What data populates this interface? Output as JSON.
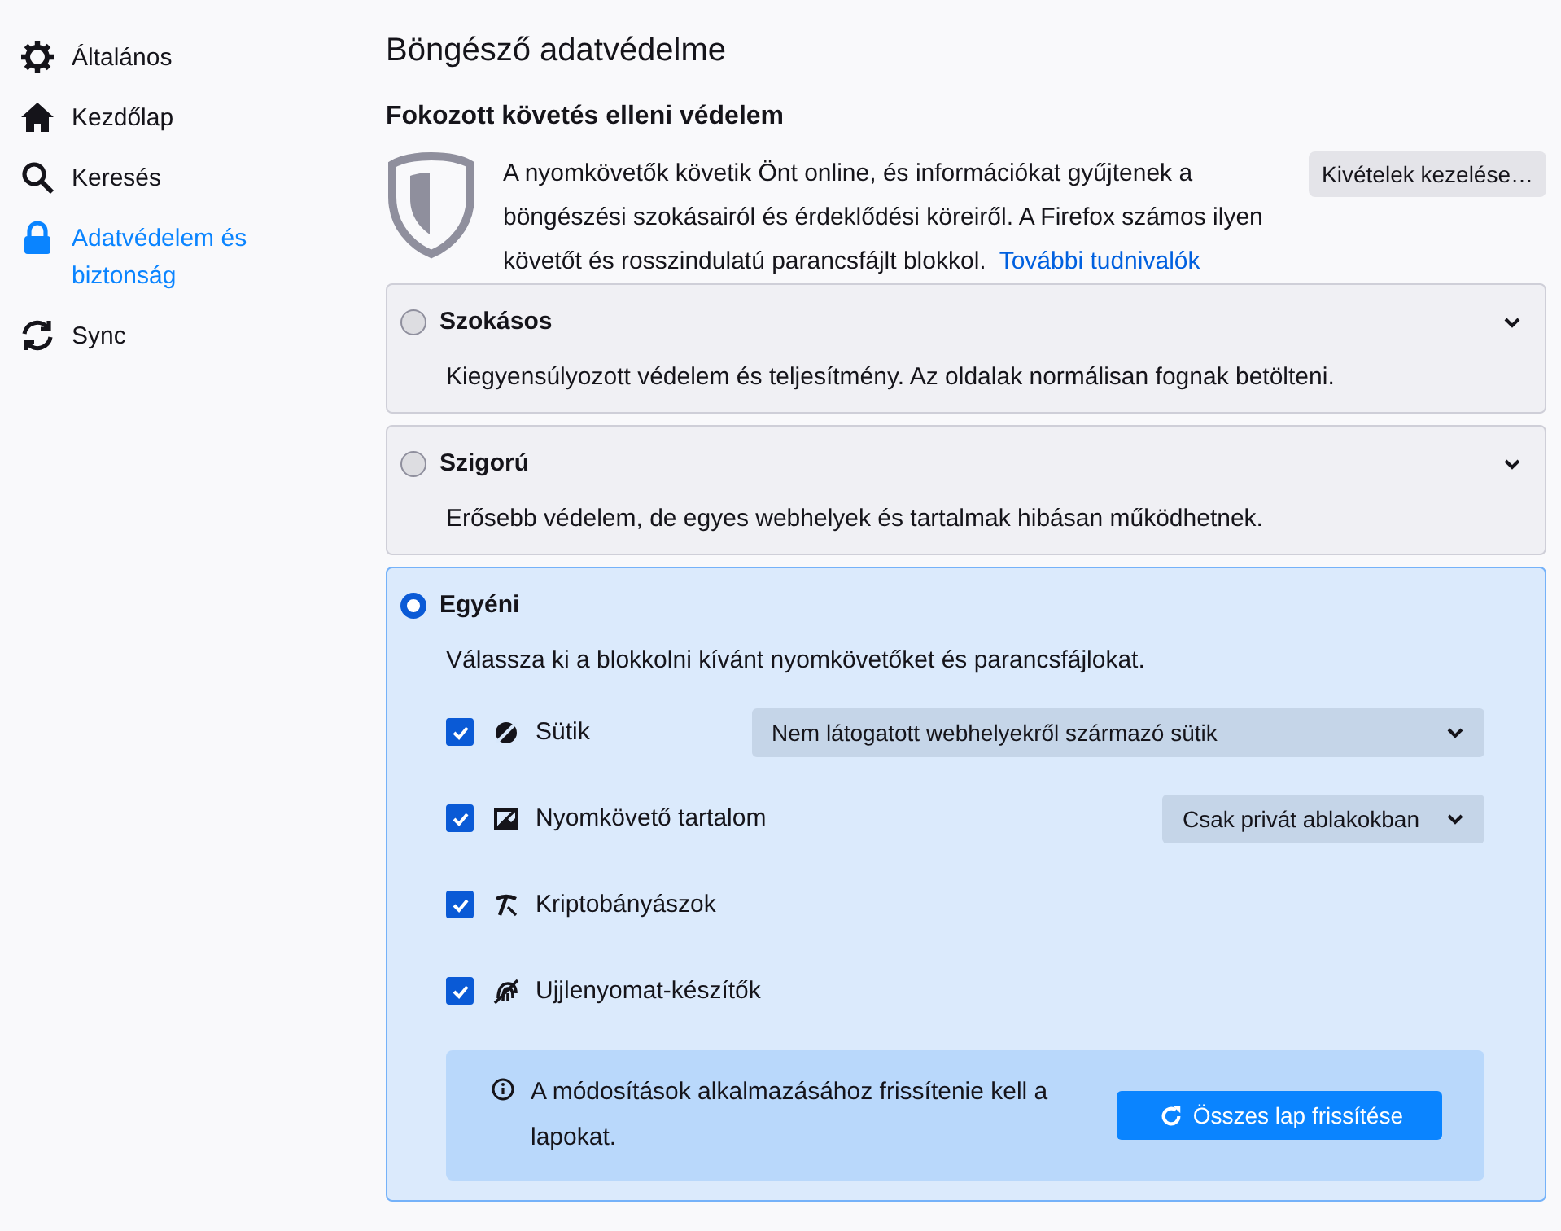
{
  "sidebar": {
    "items": [
      {
        "label": "Általános",
        "selected": false
      },
      {
        "label": "Kezdőlap",
        "selected": false
      },
      {
        "label": "Keresés",
        "selected": false
      },
      {
        "label": "Adatvédelem és biztonság",
        "selected": true
      },
      {
        "label": "Sync",
        "selected": false
      }
    ]
  },
  "page_title": "Böngésző adatvédelme",
  "section_title": "Fokozott követés elleni védelem",
  "intro": {
    "text": "A nyomkövetők követik Önt online, és információkat gyűjtenek a böngészési szokásairól és érdeklődési köreiről. A Firefox számos ilyen követőt és rosszindulatú parancsfájlt blokkol.",
    "link": "További tudnivalók",
    "button": "Kivételek kezelése…"
  },
  "options": [
    {
      "title": "Szokásos",
      "description": "Kiegyensúlyozott védelem és teljesítmény. Az oldalak normálisan fognak betölteni.",
      "selected": false,
      "expanded": false
    },
    {
      "title": "Szigorú",
      "description": "Erősebb védelem, de egyes webhelyek és tartalmak hibásan működhetnek.",
      "selected": false,
      "expanded": false
    },
    {
      "title": "Egyéni",
      "description": "Válassza ki a blokkolni kívánt nyomkövetőket és parancsfájlokat.",
      "selected": true,
      "expanded": true,
      "trackers": [
        {
          "label": "Sütik",
          "checked": true,
          "dropdown": "Nem látogatott webhelyekről származó sütik"
        },
        {
          "label": "Nyomkövető tartalom",
          "checked": true,
          "dropdown": "Csak privát ablakokban"
        },
        {
          "label": "Kriptobányászok",
          "checked": true
        },
        {
          "label": "Ujjlenyomat-készítők",
          "checked": true
        }
      ],
      "notice": {
        "text": "A módosítások alkalmazásához frissítenie kell a lapokat.",
        "button": "Összes lap frissítése"
      }
    }
  ]
}
